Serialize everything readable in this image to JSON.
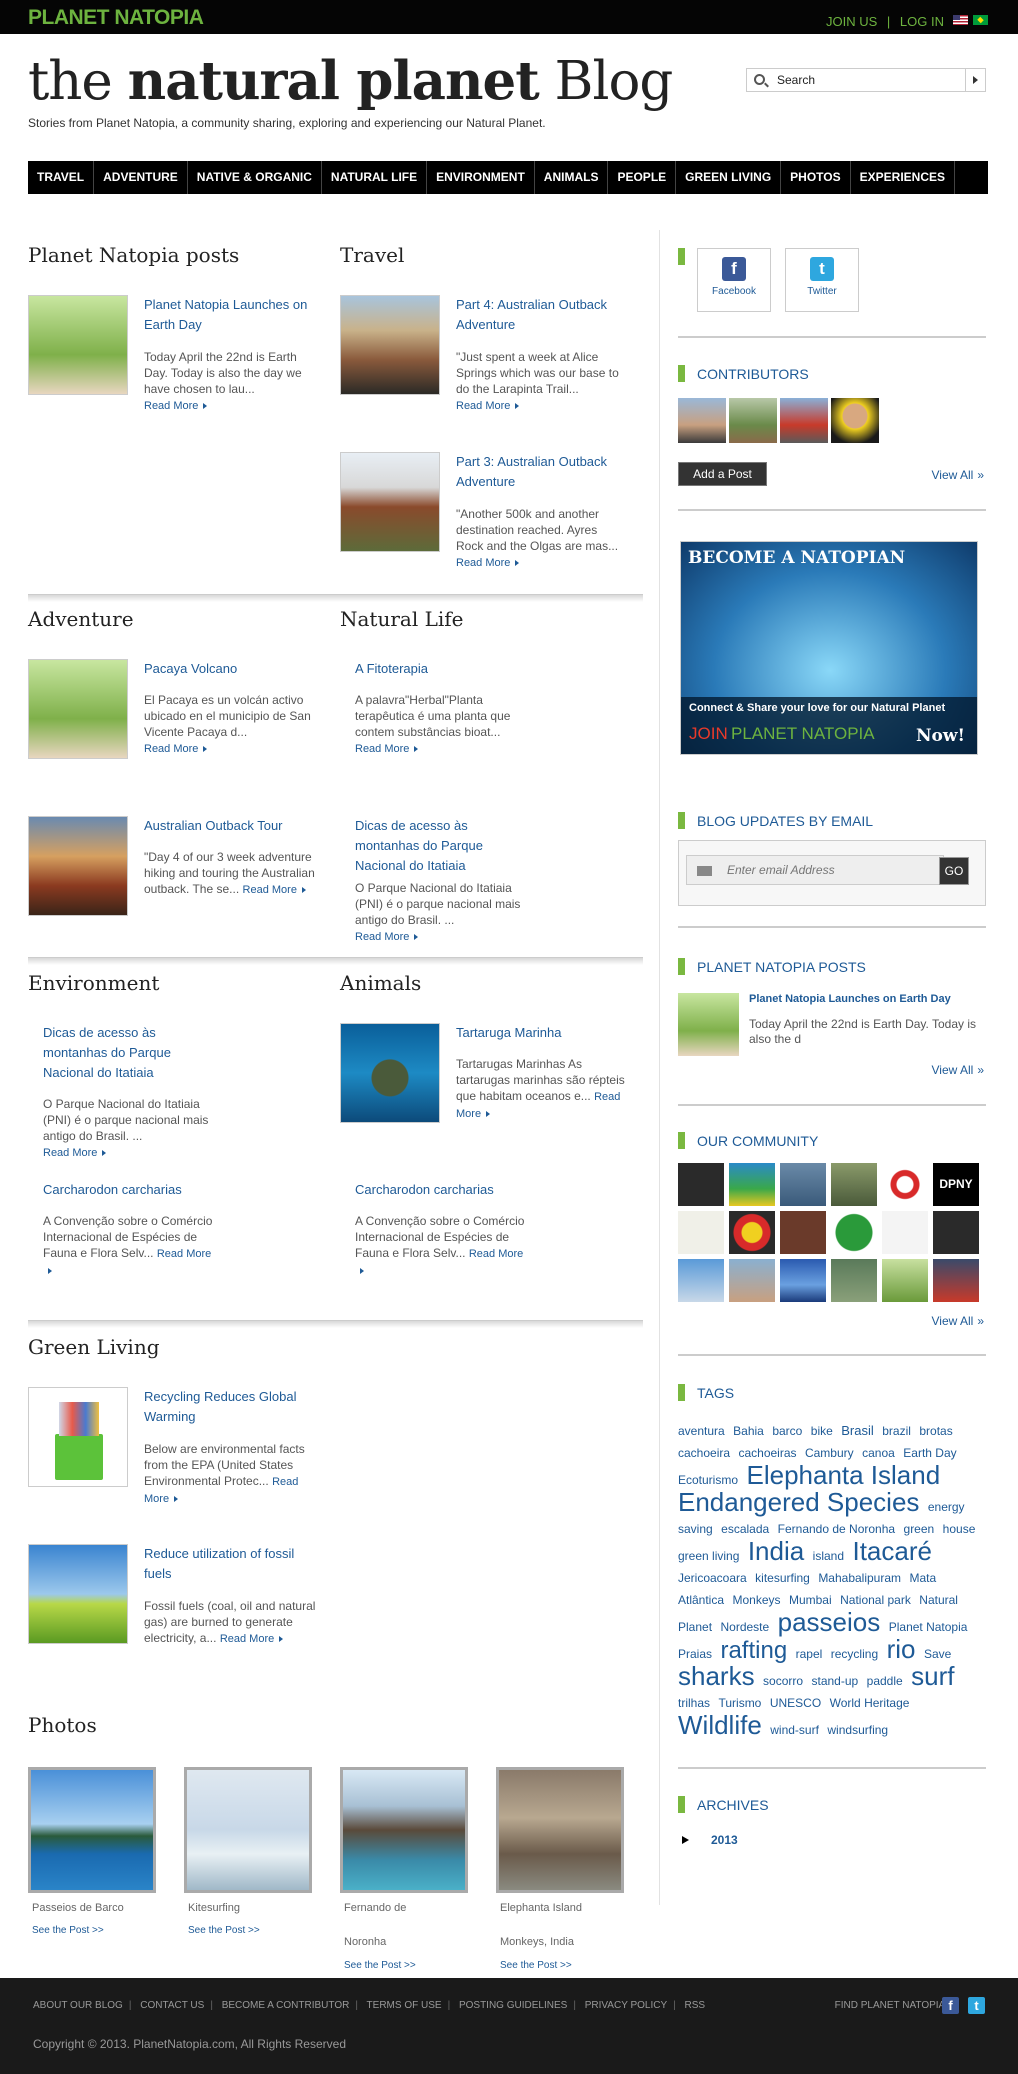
{
  "header": {
    "logo_text": "PLANET NATOPIA",
    "join_label": "JOIN US",
    "separator": "|",
    "login_label": "LOG IN",
    "site_title_prefix": "the",
    "site_title_bold": "natural planet",
    "site_title_suffix": "Blog",
    "tagline": "Stories from Planet Natopia, a community sharing, exploring and experiencing our Natural Planet.",
    "search_placeholder": "Search"
  },
  "nav": [
    "TRAVEL",
    "ADVENTURE",
    "NATIVE & ORGANIC",
    "NATURAL LIFE",
    "ENVIRONMENT",
    "ANIMALS",
    "PEOPLE",
    "GREEN LIVING",
    "PHOTOS",
    "EXPERIENCES"
  ],
  "read_more": "Read More",
  "sections": {
    "natopia_posts": {
      "heading": "Planet Natopia posts",
      "posts": [
        {
          "title": "Planet Natopia Launches on Earth Day",
          "excerpt": "Today April the 22nd is Earth Day.  Today is also the day we have chosen to lau..."
        }
      ]
    },
    "travel": {
      "heading": "Travel",
      "posts": [
        {
          "title": "Part 4: Australian Outback Adventure",
          "excerpt": "\"Just spent a week at Alice Springs which was our base to do the Larapinta Trail..."
        },
        {
          "title": "Part 3: Australian Outback Adventure",
          "excerpt": "\"Another 500k and another destination reached. Ayres Rock and the Olgas are mas..."
        }
      ]
    },
    "adventure": {
      "heading": "Adventure",
      "posts": [
        {
          "title": "Pacaya Volcano",
          "excerpt": "El Pacaya es un volcán activo ubicado en el municipio de San Vicente Pacaya d..."
        },
        {
          "title": "Australian Outback Tour",
          "excerpt": "\"Day 4 of our 3 week adventure hiking and touring the Australian outback. The se..."
        }
      ]
    },
    "natural_life": {
      "heading": "Natural Life",
      "posts": [
        {
          "title": "A Fitoterapia",
          "excerpt": "A palavra\"Herbal\"Planta terapêutica é uma planta que contem substâncias bioat..."
        },
        {
          "title": "Dicas de acesso às montanhas do Parque Nacional do Itatiaia",
          "excerpt": "O Parque Nacional do Itatiaia (PNI) é o parque nacional mais antigo do Brasil. ..."
        }
      ]
    },
    "environment": {
      "heading": "Environment",
      "posts": [
        {
          "title": "Dicas de acesso às montanhas do Parque Nacional do Itatiaia",
          "excerpt": "O Parque Nacional do Itatiaia (PNI) é o parque nacional mais antigo do Brasil. ..."
        },
        {
          "title": "Carcharodon carcharias",
          "excerpt": "A Convenção sobre o Comércio Internacional de Espécies de Fauna e Flora Selv..."
        }
      ]
    },
    "animals": {
      "heading": "Animals",
      "posts": [
        {
          "title": "Tartaruga Marinha",
          "excerpt": "Tartarugas Marinhas As tartarugas marinhas são répteis que habitam oceanos e..."
        },
        {
          "title": "Carcharodon carcharias",
          "excerpt": "A Convenção sobre o Comércio Internacional de Espécies de Fauna e Flora Selv..."
        }
      ]
    },
    "green_living": {
      "heading": "Green Living",
      "posts": [
        {
          "title": "Recycling Reduces Global Warming",
          "excerpt": "Below are environmental facts from the EPA (United States Environmental Protec..."
        },
        {
          "title": "Reduce utilization of fossil fuels",
          "excerpt": "Fossil fuels (coal, oil and natural gas) are burned to generate electricity, a..."
        }
      ]
    },
    "photos": {
      "heading": "Photos",
      "items": [
        {
          "caption": "Passeios de Barco",
          "caption2": "",
          "link": "See the Post >>"
        },
        {
          "caption": "Kitesurfing",
          "caption2": "",
          "link": "See the Post >>"
        },
        {
          "caption": "Fernando de",
          "caption2": "Noronha",
          "link": "See the Post >>"
        },
        {
          "caption": "Elephanta Island",
          "caption2": "Monkeys, India",
          "link": "See the Post >>"
        }
      ]
    }
  },
  "sidebar": {
    "social": [
      {
        "label": "Facebook",
        "glyph": "f"
      },
      {
        "label": "Twitter",
        "glyph": "t"
      }
    ],
    "contributors_heading": "CONTRIBUTORS",
    "add_post": "Add a Post",
    "view_all": "View All",
    "banner": {
      "headline": "BECOME A NATOPIAN",
      "line": "Connect & Share your love for our Natural Planet",
      "join": "JOIN",
      "brand": "PLANET NATOPIA",
      "now": "Now!"
    },
    "email_heading": "BLOG UPDATES BY EMAIL",
    "email_placeholder": "Enter email Address",
    "go": "GO",
    "posts_heading": "PLANET NATOPIA POSTS",
    "post": {
      "title": "Planet Natopia Launches on Earth Day",
      "excerpt": "Today April the 22nd is Earth Day.  Today is also the d"
    },
    "community_heading": "OUR COMMUNITY",
    "tags_heading": "TAGS",
    "tags": [
      {
        "t": "aventura",
        "s": 12
      },
      {
        "t": "Bahia",
        "s": 12
      },
      {
        "t": "barco",
        "s": 12
      },
      {
        "t": "bike",
        "s": 12
      },
      {
        "t": "Brasil",
        "s": 13
      },
      {
        "t": "brazil",
        "s": 12
      },
      {
        "t": "brotas",
        "s": 12
      },
      {
        "t": "cachoeira",
        "s": 12
      },
      {
        "t": "cachoeiras",
        "s": 12
      },
      {
        "t": "Cambury",
        "s": 12
      },
      {
        "t": "canoa",
        "s": 12
      },
      {
        "t": "Earth Day",
        "s": 12
      },
      {
        "t": "Ecoturismo",
        "s": 12
      },
      {
        "t": "Elephanta Island",
        "s": 26
      },
      {
        "t": "Endangered Species",
        "s": 26
      },
      {
        "t": "energy",
        "s": 12
      },
      {
        "t": "saving",
        "s": 12
      },
      {
        "t": "escalada",
        "s": 12
      },
      {
        "t": "Fernando de Noronha",
        "s": 12
      },
      {
        "t": "green",
        "s": 12
      },
      {
        "t": "house",
        "s": 12
      },
      {
        "t": "green living",
        "s": 12
      },
      {
        "t": "India",
        "s": 26
      },
      {
        "t": "island",
        "s": 12
      },
      {
        "t": "Itacaré",
        "s": 26
      },
      {
        "t": "Jericoacoara",
        "s": 12
      },
      {
        "t": "kitesurfing",
        "s": 12
      },
      {
        "t": "Mahabalipuram",
        "s": 12
      },
      {
        "t": "Mata",
        "s": 12
      },
      {
        "t": "Atlântica",
        "s": 12
      },
      {
        "t": "Monkeys",
        "s": 12
      },
      {
        "t": "Mumbai",
        "s": 12
      },
      {
        "t": "National park",
        "s": 12
      },
      {
        "t": "Natural",
        "s": 12
      },
      {
        "t": "Planet",
        "s": 12
      },
      {
        "t": "Nordeste",
        "s": 12
      },
      {
        "t": "passeios",
        "s": 26
      },
      {
        "t": "Planet Natopia",
        "s": 12
      },
      {
        "t": "Praias",
        "s": 12
      },
      {
        "t": "rafting",
        "s": 24
      },
      {
        "t": "rapel",
        "s": 12
      },
      {
        "t": "recycling",
        "s": 12
      },
      {
        "t": "rio",
        "s": 26
      },
      {
        "t": "Save",
        "s": 12
      },
      {
        "t": "sharks",
        "s": 26
      },
      {
        "t": "socorro",
        "s": 12
      },
      {
        "t": "stand-up",
        "s": 12
      },
      {
        "t": "paddle",
        "s": 12
      },
      {
        "t": "surf",
        "s": 26
      },
      {
        "t": "trilhas",
        "s": 12
      },
      {
        "t": "Turismo",
        "s": 12
      },
      {
        "t": "UNESCO",
        "s": 12
      },
      {
        "t": "World Heritage",
        "s": 12
      },
      {
        "t": "Wildlife",
        "s": 26
      },
      {
        "t": "wind-surf",
        "s": 12
      },
      {
        "t": "windsurfing",
        "s": 12
      }
    ],
    "archives_heading": "ARCHIVES",
    "archive_year": "2013"
  },
  "footer": {
    "links": [
      "ABOUT OUR BLOG",
      "CONTACT US",
      "BECOME A CONTRIBUTOR",
      "TERMS OF USE",
      "POSTING GUIDELINES",
      "PRIVACY POLICY",
      "RSS"
    ],
    "find_label": "FIND PLANET NATOPIA:",
    "copyright": "Copyright © 2013. PlanetNatopia.com, All Rights Reserved"
  },
  "colors": {
    "accent_green": "#7ab840",
    "link_blue": "#1e5a96",
    "nav_bg": "#000000",
    "facebook": "#3b5998",
    "twitter": "#2ea7df"
  }
}
